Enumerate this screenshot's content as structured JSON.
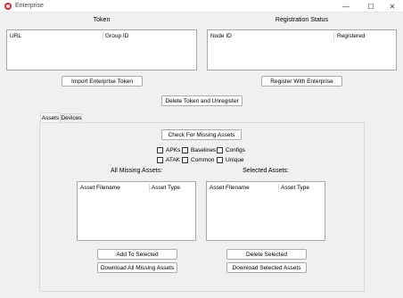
{
  "window": {
    "title": "Enterprise",
    "minimize_glyph": "—",
    "maximize_glyph": "☐",
    "close_glyph": "✕"
  },
  "token": {
    "heading": "Token",
    "columns": [
      "URL",
      "Group ID"
    ],
    "import_button": "Import Enterprise Token"
  },
  "registration": {
    "heading": "Registration Status",
    "columns": [
      "Node ID",
      "Registered"
    ],
    "register_button": "Register With Enterprise"
  },
  "delete_token_button": "Delete Token and Unregister",
  "tabs": [
    {
      "label": "Assets",
      "active": true
    },
    {
      "label": "Devices",
      "active": false
    }
  ],
  "assets": {
    "check_button": "Check For Missing Assets",
    "filters": [
      {
        "label": "APKs",
        "checked": false
      },
      {
        "label": "Baselines",
        "checked": false
      },
      {
        "label": "Configs",
        "checked": false
      },
      {
        "label": "ATAK",
        "checked": false
      },
      {
        "label": "Common",
        "checked": false
      },
      {
        "label": "Unique",
        "checked": false
      }
    ],
    "all_missing_label": "All Missing Assets:",
    "selected_label": "Selected Assets:",
    "missing_columns": [
      "Asset Filename",
      "Asset Type"
    ],
    "selected_columns": [
      "Asset Filename",
      "Asset Type"
    ],
    "add_button": "Add To Selected",
    "delete_button": "Delete Selected",
    "download_all_button": "Download All Missing Assets",
    "download_selected_button": "Download Selected Assets"
  }
}
